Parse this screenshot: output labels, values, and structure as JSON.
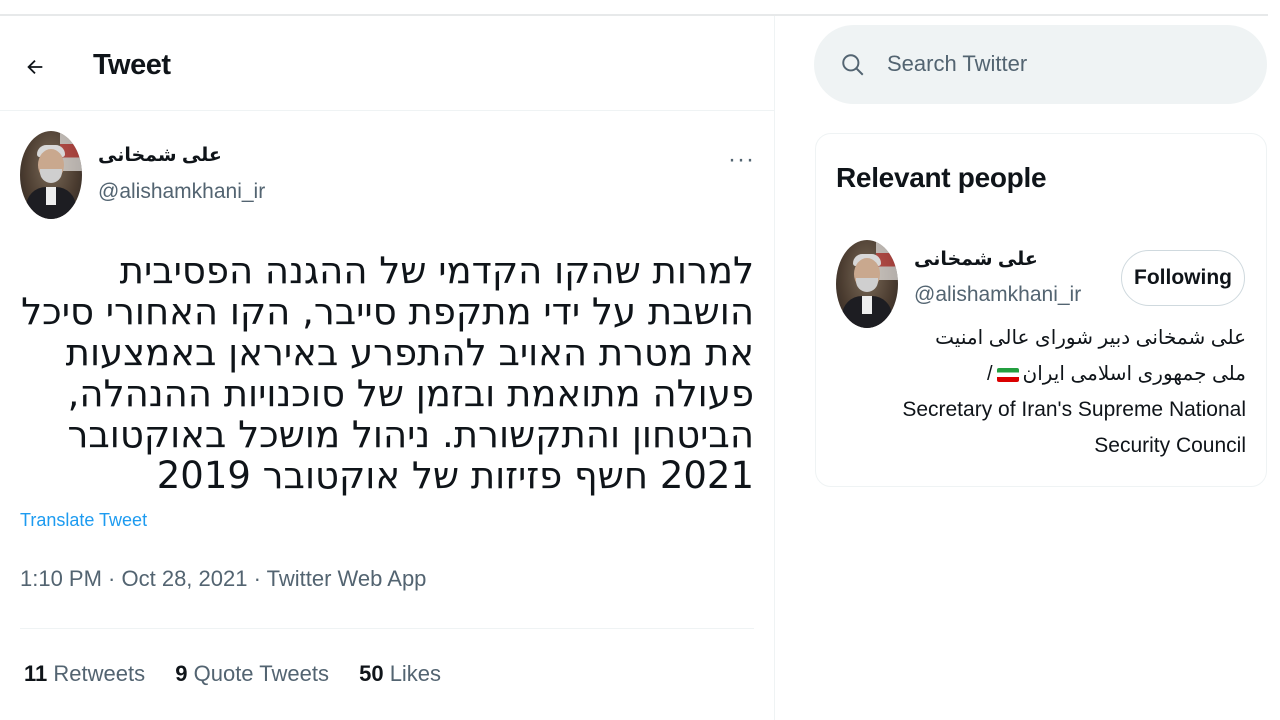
{
  "header": {
    "title": "Tweet"
  },
  "tweet": {
    "author_name": "علی شمخانی",
    "author_handle": "@alishamkhani_ir",
    "more": "···",
    "text": "למרות שהקו הקדמי של ההגנה הפסיבית הושבת על ידי מתקפת סייבר, הקו האחורי סיכל את מטרת האויב להתפרע באיראן באמצעות פעולה מתואמת ובזמן של סוכנויות ההנהלה, הביטחון והתקשורת. ניהול מושכל באוקטובר 2021 חשף פזיזות של אוקטובר 2019",
    "translate_label": "Translate Tweet",
    "time": "1:10 PM",
    "date": "Oct 28, 2021",
    "source": "Twitter Web App",
    "separator": " · ",
    "stats": {
      "retweets_count": "11",
      "retweets_label": "Retweets",
      "quotes_count": "9",
      "quotes_label": "Quote Tweets",
      "likes_count": "50",
      "likes_label": "Likes"
    }
  },
  "search": {
    "placeholder": "Search Twitter"
  },
  "relevant": {
    "title": "Relevant people",
    "name": "علی شمخانی",
    "handle": "@alishamkhani_ir",
    "follow_label": "Following",
    "bio_line1": "علی شمخانی دبیر شورای عالی امنیت",
    "bio_line2": "ملی جمهوری اسلامی ایران",
    "bio_flag": "iran-flag-emoji",
    "bio_slash": "/",
    "bio_en": "Secretary of Iran's Supreme National Security Council"
  },
  "colors": {
    "accent": "#1d9bf0",
    "muted": "#536471",
    "text": "#0f1419"
  }
}
